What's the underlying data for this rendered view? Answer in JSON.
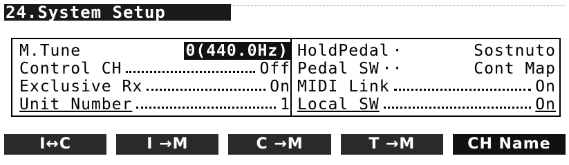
{
  "title": "24.System Setup",
  "left_params": [
    {
      "label": "M.Tune",
      "value": "0(440.0Hz)"
    },
    {
      "label": "Control CH",
      "value": "Off"
    },
    {
      "label": "Exclusive Rx",
      "value": "On"
    },
    {
      "label": "Unit Number",
      "value": "1"
    }
  ],
  "right_params": [
    {
      "label": "HoldPedal",
      "value": "Sostnuto"
    },
    {
      "label": "Pedal SW",
      "value": "Cont Map"
    },
    {
      "label": "MIDI Link",
      "value": "On"
    },
    {
      "label": "Local SW",
      "value": "On"
    }
  ],
  "softkeys": [
    "I↔C",
    "I →M",
    "C →M",
    "T →M",
    "CH Name"
  ]
}
